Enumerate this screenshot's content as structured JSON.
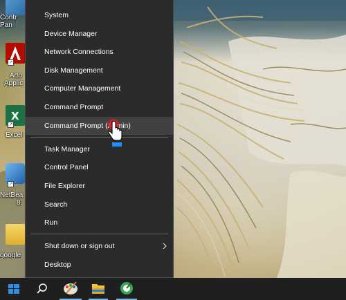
{
  "desktop": {
    "icons": [
      {
        "name": "control-panel",
        "label_lines": [
          "Contr",
          "Pan"
        ]
      },
      {
        "name": "adobe-application",
        "label_lines": [
          "Ado",
          "Applic"
        ]
      },
      {
        "name": "excel",
        "label_lines": [
          "Excel"
        ]
      },
      {
        "name": "netbeans",
        "label_lines": [
          "NetBea",
          "8."
        ]
      },
      {
        "name": "google-folder",
        "label_lines": [
          "google"
        ]
      }
    ]
  },
  "menu": {
    "items": [
      {
        "label": "System"
      },
      {
        "label": "Device Manager"
      },
      {
        "label": "Network Connections"
      },
      {
        "label": "Disk Management"
      },
      {
        "label": "Computer Management"
      },
      {
        "label": "Command Prompt"
      },
      {
        "label": "Command Prompt (Admin)",
        "highlighted": true
      },
      {
        "label": "Task Manager"
      },
      {
        "label": "Control Panel"
      },
      {
        "label": "File Explorer"
      },
      {
        "label": "Search"
      },
      {
        "label": "Run"
      },
      {
        "label": "Shut down or sign out",
        "has_submenu": true
      },
      {
        "label": "Desktop"
      }
    ]
  },
  "taskbar": {
    "buttons": [
      "start-button",
      "search-button",
      "paint-app",
      "file-explorer-app",
      "app-icon-green"
    ]
  },
  "colors": {
    "menu_bg": "#2b2b2b",
    "menu_highlight": "#414141",
    "taskbar_bg": "#1f1f1f",
    "start_blue": "#2f8fe0",
    "active_indicator": "#77b4e8"
  }
}
